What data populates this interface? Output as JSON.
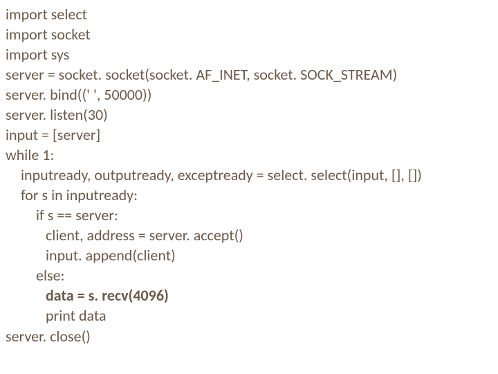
{
  "code": {
    "l1": "import select",
    "l2": "import socket",
    "l3": "import sys",
    "l4": "server = socket. socket(socket. AF_INET, socket. SOCK_STREAM)",
    "l5": "server. bind((' ', 50000))",
    "l6": "server. listen(30)",
    "l7": "input = [server]",
    "l8": "while 1:",
    "l9": "inputready, outputready, exceptready = select. select(input, [], [])",
    "l10": "for s in inputready:",
    "l11": "if s == server:",
    "l12": "client, address = server. accept()",
    "l13": "input. append(client)",
    "l14": "else:",
    "l15": "data = s. recv(4096)",
    "l16": "print data",
    "l17": "server. close()"
  }
}
